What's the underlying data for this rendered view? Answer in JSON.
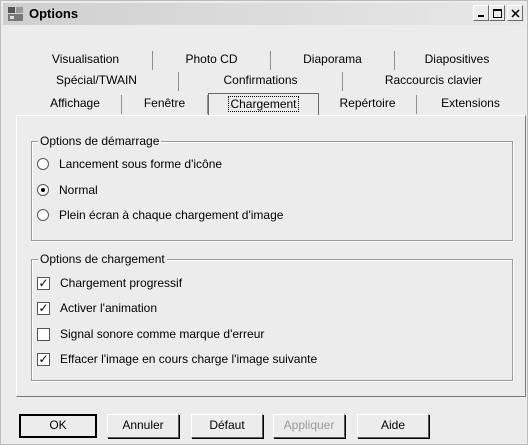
{
  "window": {
    "title": "Options"
  },
  "tabs": {
    "row1": [
      "Visualisation",
      "Photo CD",
      "Diaporama",
      "Diapositives"
    ],
    "row2": [
      "Spécial/TWAIN",
      "Confirmations",
      "Raccourcis clavier"
    ],
    "row3": [
      "Affichage",
      "Fenêtre",
      "Chargement",
      "Repértoire",
      "Extensions"
    ],
    "active": "Chargement"
  },
  "startup": {
    "legend": "Options de démarrage",
    "options": [
      {
        "label": "Lancement sous forme d'icône",
        "selected": false
      },
      {
        "label": "Normal",
        "selected": true
      },
      {
        "label": "Plein écran à chaque chargement d'image",
        "selected": false
      }
    ]
  },
  "loading": {
    "legend": "Options de chargement",
    "options": [
      {
        "label": "Chargement progressif",
        "checked": true
      },
      {
        "label": "Activer l'animation",
        "checked": true
      },
      {
        "label": "Signal sonore comme marque d'erreur",
        "checked": false
      },
      {
        "label": "Effacer l'image en cours charge l'image suivante",
        "checked": true
      }
    ]
  },
  "buttons": {
    "ok": "OK",
    "cancel": "Annuler",
    "default": "Défaut",
    "apply": "Appliquer",
    "help": "Aide"
  }
}
